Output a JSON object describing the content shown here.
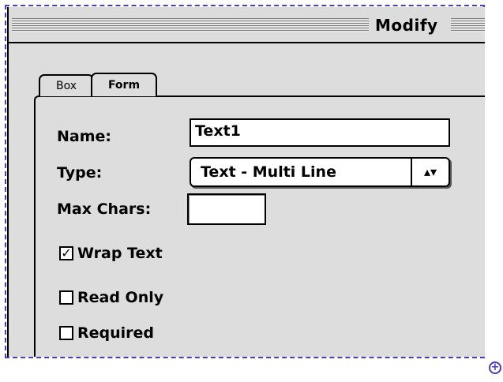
{
  "window": {
    "title": "Modify"
  },
  "tabs": [
    {
      "label": "Box",
      "active": false
    },
    {
      "label": "Form",
      "active": true
    }
  ],
  "form": {
    "name_label": "Name:",
    "name_value": "Text1",
    "type_label": "Type:",
    "type_value": "Text - Multi Line",
    "max_chars_label": "Max Chars:",
    "max_chars_value": ""
  },
  "options": [
    {
      "label": "Wrap Text",
      "checked": true
    },
    {
      "label": "Read Only",
      "checked": false
    },
    {
      "label": "Required",
      "checked": false
    }
  ],
  "icons": {
    "zoom": "zoom-in-icon",
    "popup_arrow": "up-down-arrows-icon",
    "check": "checkmark-icon"
  },
  "colors": {
    "selection_marquee": "#4a3fb0",
    "palette_bg": "#dddddd"
  }
}
